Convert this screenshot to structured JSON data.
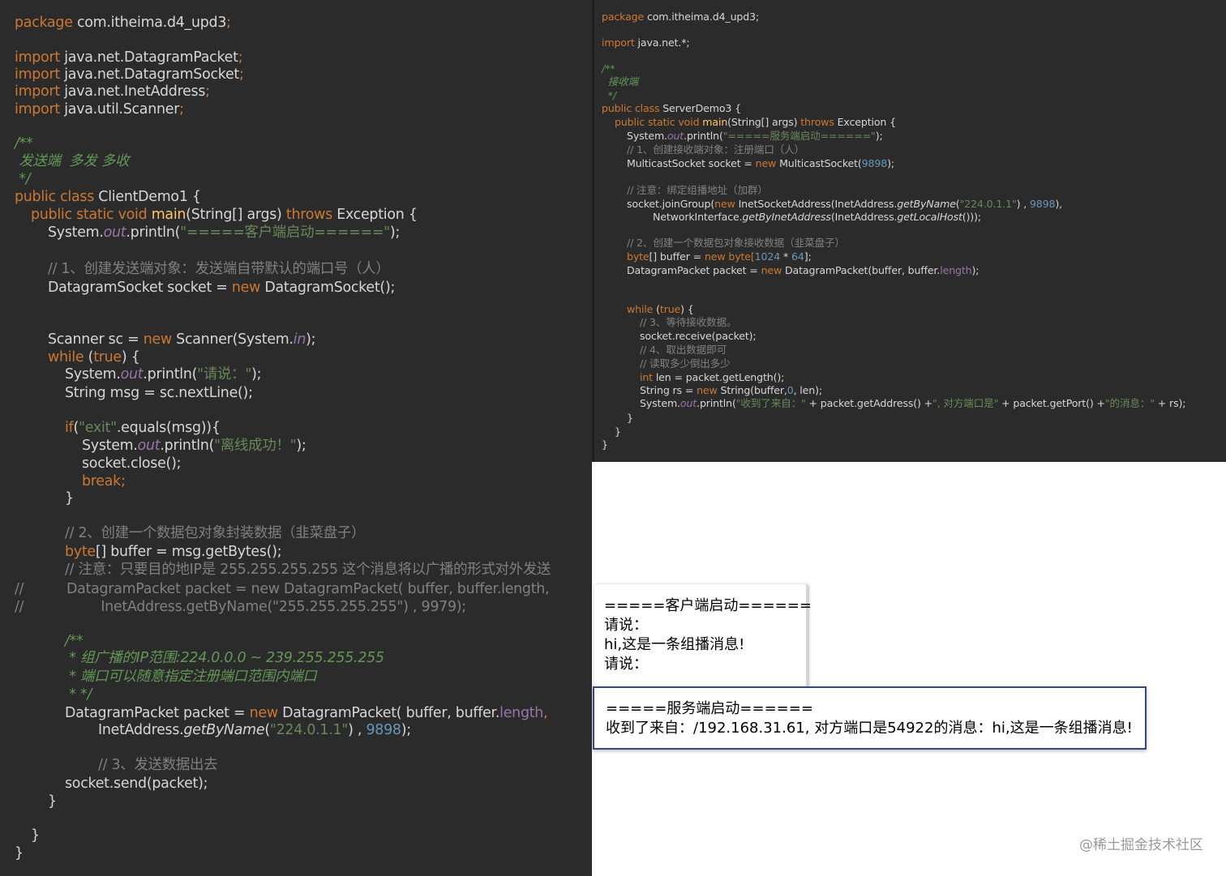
{
  "client_code": {
    "package_kw": "package",
    "package_name": " com.itheima.d4_upd3",
    "import_kw": "import",
    "imports": [
      " java.net.DatagramPacket",
      " java.net.DatagramSocket",
      " java.net.InetAddress",
      " java.util.Scanner"
    ],
    "doc_open": "/**",
    "doc_text": " 发送端  多发 多收",
    "doc_close": " */",
    "public_class_kw": "public class",
    "class_decl": " ClientDemo1 {",
    "main_kw": "public static void",
    "main_name": "main",
    "main_args": "(String[] args) ",
    "throws_kw": "throws",
    "throws_rest": " Exception {",
    "sysout_prefix": "System.",
    "out": "out",
    "println_open": ".println(",
    "start_str": "\"=====客户端启动======\"",
    "close_semi": ");",
    "comment1": "// 1、创建发送端对象：发送端自带默认的端口号（人）",
    "socket_decl": "DatagramSocket socket = ",
    "new_kw": "new",
    "socket_ctor": " DatagramSocket();",
    "scanner_decl": "Scanner sc = ",
    "scanner_ctor": " Scanner(System.",
    "in": "in",
    "while_kw": "while",
    "true_kw": "true",
    "while_rest": ") {",
    "prompt_str": "\"请说：\"",
    "msg_line": "String msg = sc.nextLine();",
    "if_kw": "if",
    "exit_str": "\"exit\"",
    "if_rest": ".equals(msg)){",
    "offline_str": "\"离线成功！\"",
    "close_line": "socket.close();",
    "break_kw": "break;",
    "rbrace": "}",
    "comment2": "// 2、创建一个数据包对象封装数据（韭菜盘子）",
    "byte_kw": "byte",
    "buffer_line": "[] buffer = msg.getBytes();",
    "comment_note": "// 注意：只要目的地IP是 255.255.255.255 这个消息将以广播的形式对外发送",
    "commented_a": "//          DatagramPacket packet = new DatagramPacket( buffer, buffer.length,",
    "commented_b": "//                  InetAddress.getByName(\"255.255.255.255\") , 9979);",
    "doc2_open": "/**",
    "doc2_l1": " * 组广播的IP范围:224.0.0.0 ~ 239.255.255.255",
    "doc2_l2": " * 端口可以随意指定注册端口范围内端口",
    "doc2_l3": " * */",
    "packet_decl": "DatagramPacket packet = ",
    "packet_ctor": " DatagramPacket( buffer, buffer.",
    "length": "length",
    "comma": ",",
    "inet_prefix": "InetAddress.",
    "get_by_name": "getByName",
    "multicast_ip": "\"224.0.1.1\"",
    "port": "9898",
    "comment3": "// 3、发送数据出去",
    "send_line": "socket.send(packet);"
  },
  "server_code": {
    "package_line": " com.itheima.d4_upd3;",
    "import_line": " java.net.*;",
    "doc_open": "/**",
    "doc_text": "  接收端",
    "doc_close": "  */",
    "class_decl": " ServerDemo3 {",
    "start_str": "\"=====服务端启动======\"",
    "comment1": "// 1、创建接收端对象：注册端口（人）",
    "ms_decl": "MulticastSocket socket = ",
    "ms_ctor": " MulticastSocket(",
    "comment_note": "// 注意：绑定组播地址（加群）",
    "join_prefix": "socket.joinGroup(",
    "isa_ctor": " InetSocketAddress(InetAddress.",
    "ni_prefix": "NetworkInterface.",
    "ni_method": "getByInetAddress",
    "ni_mid": "(InetAddress.",
    "local_host": "getLocalHost",
    "ni_end": "()));",
    "comment2": "// 2、创建一个数据包对象接收数据（韭菜盘子）",
    "buf_mid": "[] buffer = ",
    "buf_byte": " byte[",
    "num1024": "1024",
    "times": " * ",
    "num64": "64",
    "buf_end": "];",
    "packet_decl": "DatagramPacket packet = ",
    "packet_ctor": " DatagramPacket(buffer, buffer.",
    "comment3": "// 3、等待接收数据。",
    "receive_line": "socket.receive(packet);",
    "comment4": "// 4、取出数据即可",
    "comment5": "// 读取多少倒出多少",
    "int_kw": "int",
    "len_line": " len = packet.getLength();",
    "rs_decl": "String rs = ",
    "rs_ctor": " String(buffer,",
    "zero": "0",
    "rs_end": ", len);",
    "recv_str": "\"收到了来自：\"",
    "recv_mid1": " + packet.getAddress() +",
    "recv_str2": "\", 对方端口是\"",
    "recv_mid2": " + packet.getPort() +",
    "recv_str3": "\"的消息：\"",
    "recv_end": " + rs);"
  },
  "client_console": {
    "lines": [
      "=====客户端启动======",
      "请说：",
      "hi,这是一条组播消息!",
      "请说："
    ]
  },
  "server_console": {
    "lines": [
      "=====服务端启动======",
      "收到了来自：/192.168.31.61, 对方端口是54922的消息：hi,这是一条组播消息!"
    ]
  },
  "watermark": "@稀土掘金技术社区"
}
